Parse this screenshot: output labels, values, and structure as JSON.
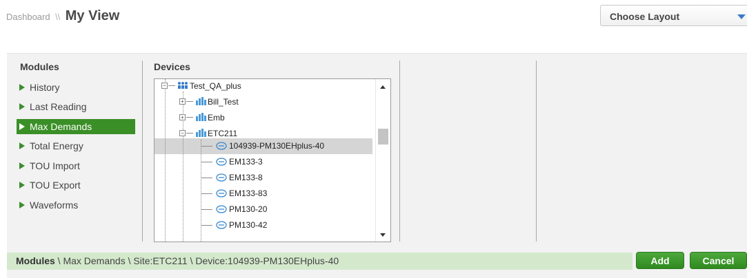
{
  "header": {
    "breadcrumb_root": "Dashboard",
    "separator": "\\\\",
    "page_title": "My View"
  },
  "layout_select": {
    "selected": "Choose Layout"
  },
  "modules": {
    "heading": "Modules",
    "items": [
      {
        "label": "History",
        "active": false
      },
      {
        "label": "Last Reading",
        "active": false
      },
      {
        "label": "Max Demands",
        "active": true
      },
      {
        "label": "Total Energy",
        "active": false
      },
      {
        "label": "TOU Import",
        "active": false
      },
      {
        "label": "TOU Export",
        "active": false
      },
      {
        "label": "Waveforms",
        "active": false
      }
    ]
  },
  "devices": {
    "heading": "Devices",
    "tree": {
      "root": "Test_QA_plus",
      "sites": [
        "Bill_Test",
        "Emb",
        "ETC211"
      ],
      "devices": [
        "104939-PM130EHplus-40",
        "EM133-3",
        "EM133-8",
        "EM133-83",
        "PM130-20",
        "PM130-42"
      ],
      "selected": "104939-PM130EHplus-40"
    }
  },
  "footer": {
    "modules_label": "Modules",
    "path": " \\ Max Demands \\ Site:ETC211 \\ Device:104939-PM130EHplus-40"
  },
  "buttons": {
    "add": "Add",
    "cancel": "Cancel"
  },
  "colors": {
    "accent_green": "#3a8f27",
    "footer_bg": "#d4e9cc",
    "caret_blue": "#3a7bc8"
  },
  "icons": {
    "root": "group-icon",
    "site": "site-building-icon",
    "device": "meter-device-icon"
  }
}
